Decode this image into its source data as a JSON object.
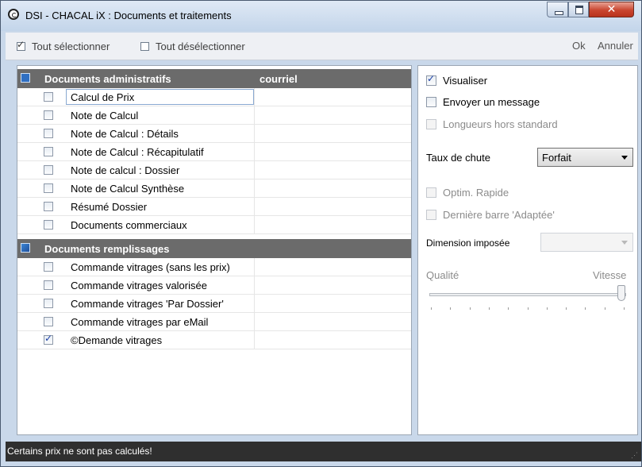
{
  "window": {
    "title": "DSI - CHACAL iX : Documents et traitements"
  },
  "toolbar": {
    "select_all": "Tout sélectionner",
    "deselect_all": "Tout désélectionner",
    "ok": "Ok",
    "cancel": "Annuler"
  },
  "groups": [
    {
      "title": "Documents administratifs",
      "column2": "courriel",
      "items": [
        {
          "label": "Calcul de Prix",
          "checked": false
        },
        {
          "label": "Note de Calcul",
          "checked": false
        },
        {
          "label": "Note de Calcul : Détails",
          "checked": false
        },
        {
          "label": "Note de Calcul : Récapitulatif",
          "checked": false
        },
        {
          "label": "Note de calcul : Dossier",
          "checked": false
        },
        {
          "label": "Note de Calcul Synthèse",
          "checked": false
        },
        {
          "label": "Résumé Dossier",
          "checked": false
        },
        {
          "label": "Documents commerciaux",
          "checked": false
        }
      ]
    },
    {
      "title": "Documents remplissages",
      "column2": "",
      "items": [
        {
          "label": "Commande vitrages (sans les prix)",
          "checked": false
        },
        {
          "label": "Commande vitrages valorisée",
          "checked": false
        },
        {
          "label": "Commande vitrages 'Par Dossier'",
          "checked": false
        },
        {
          "label": "Commande vitrages par eMail",
          "checked": false
        },
        {
          "label": "©Demande vitrages",
          "checked": true
        }
      ]
    }
  ],
  "options": {
    "visualize": {
      "label": "Visualiser",
      "checked": true
    },
    "send_message": {
      "label": "Envoyer un message",
      "checked": false
    },
    "nonstandard_lengths": {
      "label": "Longueurs hors standard",
      "checked": false,
      "disabled": true
    },
    "drop_rate_label": "Taux de chute",
    "drop_rate_value": "Forfait",
    "quick_optim": {
      "label": "Optim. Rapide",
      "checked": false,
      "disabled": true
    },
    "last_bar_adapted": {
      "label": "Dernière barre 'Adaptée'",
      "checked": false,
      "disabled": true
    },
    "imposed_dimension_label": "Dimension imposée",
    "imposed_dimension_value": "",
    "quality_label": "Qualité",
    "speed_label": "Vitesse",
    "quality_speed_level": 1.0
  },
  "status": {
    "message": "Certains prix ne sont pas calculés!"
  },
  "colors": {
    "group_header": "#6b6b6b",
    "status_bar": "#2f2f2f",
    "window_frame": "#c9d8ea"
  }
}
